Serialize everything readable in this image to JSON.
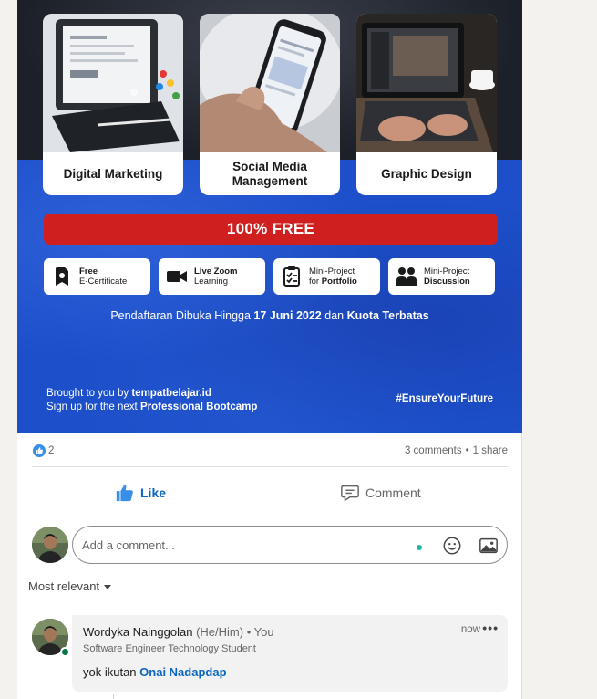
{
  "banner": {
    "courses": [
      {
        "title_line1": "Digital Marketing",
        "title_line2": "",
        "photo": "tablet-keyboard-photo"
      },
      {
        "title_line1": "Social Media",
        "title_line2": "Management",
        "photo": "phone-in-hand-photo"
      },
      {
        "title_line1": "Graphic Design",
        "title_line2": "",
        "photo": "laptop-photo"
      }
    ],
    "free_label": "100% FREE",
    "features": [
      {
        "line1": "Free",
        "line2": "E-Certificate",
        "icon": "certificate-icon",
        "bold": "line1"
      },
      {
        "line1": "Live Zoom",
        "line2": "Learning",
        "icon": "video-camera-icon",
        "bold": "line1"
      },
      {
        "line1": "Mini-Project",
        "line2_pre": "for ",
        "line2_bold": "Portfolio",
        "icon": "checklist-icon"
      },
      {
        "line1": "Mini-Project",
        "line2": "Discussion",
        "icon": "people-icon",
        "bold": "line2"
      }
    ],
    "registration": {
      "pre": "Pendaftaran Dibuka Hingga ",
      "date": "17 Juni 2022",
      "mid": " dan ",
      "quota": "Kuota Terbatas"
    },
    "brought": {
      "pre": "Brought to you by ",
      "brand": "tempatbelajar.id",
      "line2_pre": "Sign up for the next ",
      "line2_bold": "Professional Bootcamp"
    },
    "hashtag": "#EnsureYourFuture"
  },
  "social": {
    "reaction_count": "2",
    "comments": "3 comments",
    "separator": "•",
    "shares": "1 share"
  },
  "actions": {
    "like": "Like",
    "comment": "Comment"
  },
  "comment_box": {
    "placeholder": "Add a comment..."
  },
  "sort": {
    "label": "Most relevant"
  },
  "comments": [
    {
      "author": "Wordyka Nainggolan",
      "pronouns": "(He/Him)",
      "relation": "• You",
      "headline": "Software Engineer Technology Student",
      "time": "now",
      "more": "•••",
      "text": "yok ikutan ",
      "mention": "Onai Nadapdap"
    }
  ],
  "colors": {
    "accent": "#0a66c2",
    "free_bar": "#cf1f1f",
    "banner_blue": "#1c4fc9",
    "online": "#057642"
  }
}
